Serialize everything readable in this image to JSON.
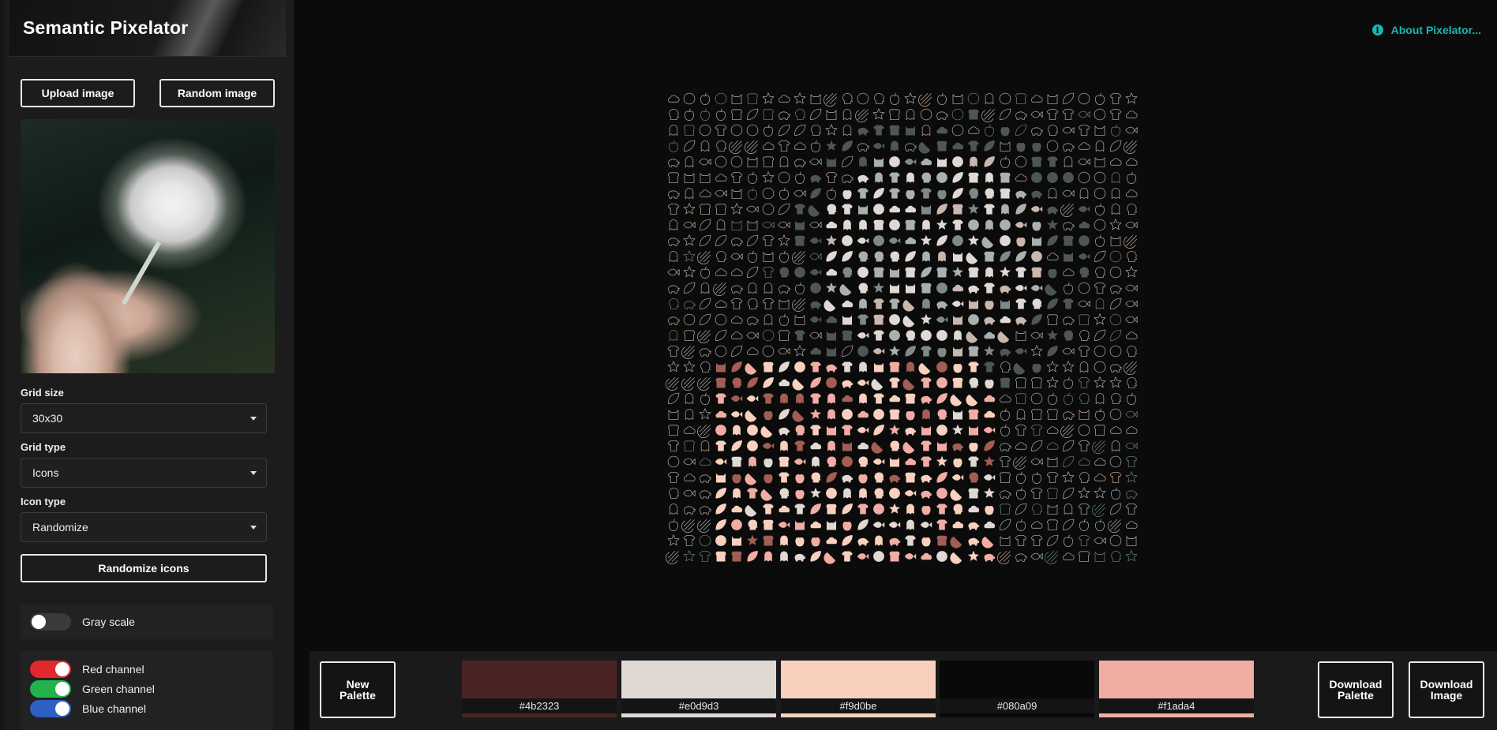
{
  "app": {
    "title": "Semantic Pixelator"
  },
  "sidebar": {
    "upload_label": "Upload image",
    "random_label": "Random image",
    "grid_size": {
      "label": "Grid size",
      "value": "30x30"
    },
    "grid_type": {
      "label": "Grid type",
      "value": "Icons"
    },
    "icon_type": {
      "label": "Icon type",
      "value": "Randomize"
    },
    "randomize_icons_label": "Randomize icons",
    "gray_scale": {
      "label": "Gray scale",
      "on": false
    },
    "channels": [
      {
        "label": "Red channel",
        "on": true,
        "color": "#e0282e"
      },
      {
        "label": "Green channel",
        "on": true,
        "color": "#22b34a"
      },
      {
        "label": "Blue channel",
        "on": true,
        "color": "#2f5fc4"
      }
    ]
  },
  "header": {
    "about_label": "About Pixelator..."
  },
  "mosaic": {
    "rows": 30,
    "cols": 30,
    "icon_set": [
      "shirt-icon",
      "circle-icon",
      "stripes-icon",
      "bread-icon",
      "ghost-icon",
      "apple-icon",
      "cloud-icon",
      "cat-icon",
      "star-icon",
      "leaf-icon",
      "fish-icon",
      "pig-icon",
      "head-icon"
    ]
  },
  "palette": {
    "new_palette_label": "New\nPalette",
    "download_palette_label": "Download\nPalette",
    "download_image_label": "Download\nImage",
    "swatches": [
      {
        "hex": "#4b2323"
      },
      {
        "hex": "#e0d9d3"
      },
      {
        "hex": "#f9d0be"
      },
      {
        "hex": "#080a09"
      },
      {
        "hex": "#f1ada4"
      }
    ]
  }
}
